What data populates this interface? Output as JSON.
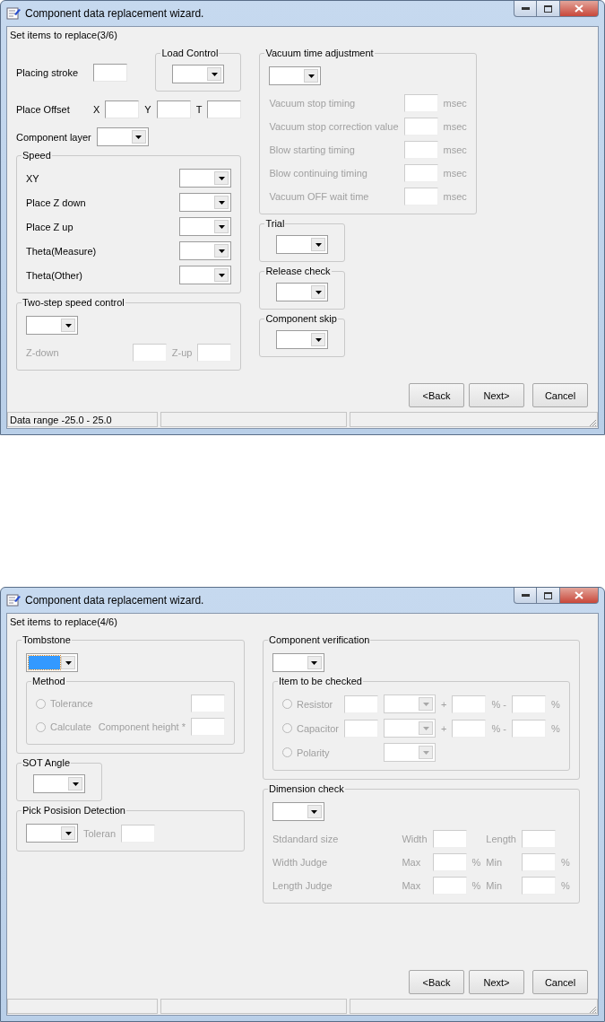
{
  "windows": [
    {
      "title": "Component data replacement wizard.",
      "subtitle": "Set items to replace(3/6)",
      "columns": [
        [
          {
            "kind": "row",
            "disabled": false,
            "parts": [
              {
                "kind": "label",
                "text": "Placing stroke"
              },
              {
                "kind": "field"
              },
              {
                "kind": "group",
                "title": "Load Control",
                "items": [
                  {
                    "kind": "row",
                    "disabled": false,
                    "parts": [
                      {
                        "kind": "combo"
                      }
                    ]
                  }
                ]
              }
            ]
          },
          {
            "kind": "row",
            "disabled": false,
            "parts": [
              {
                "kind": "label",
                "text": "Place Offset"
              },
              {
                "kind": "label",
                "text": "X"
              },
              {
                "kind": "field"
              },
              {
                "kind": "label",
                "text": "Y"
              },
              {
                "kind": "field"
              },
              {
                "kind": "label",
                "text": "T"
              },
              {
                "kind": "field"
              }
            ]
          },
          {
            "kind": "row",
            "disabled": false,
            "parts": [
              {
                "kind": "label",
                "text": "Component layer"
              },
              {
                "kind": "combo"
              }
            ]
          },
          {
            "kind": "group",
            "title": "Speed",
            "items": [
              {
                "kind": "table",
                "rows": [
                  {
                    "disabled": false,
                    "parts": [
                      {
                        "kind": "label",
                        "text": "XY"
                      },
                      {
                        "kind": "combo"
                      }
                    ]
                  },
                  {
                    "disabled": false,
                    "parts": [
                      {
                        "kind": "label",
                        "text": "Place Z down"
                      },
                      {
                        "kind": "combo"
                      }
                    ]
                  },
                  {
                    "disabled": false,
                    "parts": [
                      {
                        "kind": "label",
                        "text": "Place Z up"
                      },
                      {
                        "kind": "combo"
                      }
                    ]
                  },
                  {
                    "disabled": false,
                    "parts": [
                      {
                        "kind": "label",
                        "text": "Theta(Measure)"
                      },
                      {
                        "kind": "combo"
                      }
                    ]
                  },
                  {
                    "disabled": false,
                    "parts": [
                      {
                        "kind": "label",
                        "text": "Theta(Other)"
                      },
                      {
                        "kind": "combo"
                      }
                    ]
                  }
                ]
              }
            ]
          },
          {
            "kind": "group",
            "title": "Two-step speed control",
            "items": [
              {
                "kind": "row",
                "disabled": false,
                "parts": [
                  {
                    "kind": "combo"
                  }
                ]
              },
              {
                "kind": "table",
                "rows": [
                  {
                    "disabled": true,
                    "parts": [
                      {
                        "kind": "label",
                        "text": "Z-down"
                      },
                      {
                        "kind": "field"
                      },
                      {
                        "kind": "label",
                        "text": "Z-up"
                      },
                      {
                        "kind": "field"
                      }
                    ]
                  }
                ]
              }
            ]
          }
        ],
        [
          {
            "kind": "group",
            "title": "Vacuum time adjustment",
            "items": [
              {
                "kind": "row",
                "disabled": false,
                "parts": [
                  {
                    "kind": "combo"
                  }
                ]
              },
              {
                "kind": "table",
                "rows": [
                  {
                    "disabled": true,
                    "parts": [
                      {
                        "kind": "label",
                        "text": "Vacuum stop timing"
                      },
                      {
                        "kind": "field"
                      },
                      {
                        "kind": "unit",
                        "text": "msec"
                      }
                    ]
                  },
                  {
                    "disabled": true,
                    "parts": [
                      {
                        "kind": "label",
                        "text": "Vacuum stop correction value"
                      },
                      {
                        "kind": "field"
                      },
                      {
                        "kind": "unit",
                        "text": "msec"
                      }
                    ]
                  },
                  {
                    "disabled": true,
                    "parts": [
                      {
                        "kind": "label",
                        "text": "Blow starting timing"
                      },
                      {
                        "kind": "field"
                      },
                      {
                        "kind": "unit",
                        "text": "msec"
                      }
                    ]
                  },
                  {
                    "disabled": true,
                    "parts": [
                      {
                        "kind": "label",
                        "text": "Blow continuing timing"
                      },
                      {
                        "kind": "field"
                      },
                      {
                        "kind": "unit",
                        "text": "msec"
                      }
                    ]
                  },
                  {
                    "disabled": true,
                    "parts": [
                      {
                        "kind": "label",
                        "text": "Vacuum OFF wait time"
                      },
                      {
                        "kind": "field"
                      },
                      {
                        "kind": "unit",
                        "text": "msec"
                      }
                    ]
                  }
                ]
              }
            ]
          },
          {
            "kind": "group",
            "title": "Trial",
            "items": [
              {
                "kind": "row",
                "disabled": false,
                "parts": [
                  {
                    "kind": "combo"
                  }
                ]
              }
            ]
          },
          {
            "kind": "group",
            "title": "Release check",
            "items": [
              {
                "kind": "row",
                "disabled": false,
                "parts": [
                  {
                    "kind": "combo"
                  }
                ]
              }
            ]
          },
          {
            "kind": "group",
            "title": "Component skip",
            "items": [
              {
                "kind": "row",
                "disabled": false,
                "parts": [
                  {
                    "kind": "combo"
                  }
                ]
              }
            ]
          }
        ]
      ],
      "buttons": [
        {
          "label": "<Back"
        },
        {
          "label": "Next>"
        },
        {
          "label": "Cancel"
        }
      ],
      "status_text": "Data range  -25.0 - 25.0"
    },
    {
      "title": "Component data replacement wizard.",
      "subtitle": "Set items to replace(4/6)",
      "columns": [
        [
          {
            "kind": "group",
            "title": "Tombstone",
            "items": [
              {
                "kind": "row",
                "disabled": false,
                "parts": [
                  {
                    "kind": "combo",
                    "focused": true
                  }
                ]
              },
              {
                "kind": "group",
                "title": "Method",
                "items": [
                  {
                    "kind": "table",
                    "rows": [
                      {
                        "disabled": true,
                        "parts": [
                          {
                            "kind": "radio",
                            "text": "Tolerance",
                            "checked": false
                          },
                          {
                            "kind": "field"
                          }
                        ]
                      },
                      {
                        "disabled": true,
                        "parts": [
                          {
                            "kind": "radio",
                            "text": "Calculate",
                            "checked": false
                          },
                          {
                            "kind": "label",
                            "text": "Component height *"
                          },
                          {
                            "kind": "field"
                          }
                        ]
                      }
                    ]
                  }
                ]
              }
            ]
          },
          {
            "kind": "group",
            "title": "SOT Angle",
            "items": [
              {
                "kind": "row",
                "disabled": false,
                "parts": [
                  {
                    "kind": "combo"
                  }
                ]
              }
            ]
          },
          {
            "kind": "group",
            "title": "Pick Posision Detection",
            "items": [
              {
                "kind": "row",
                "parts": [
                  {
                    "kind": "combo",
                    "disabled": false
                  },
                  {
                    "kind": "label",
                    "text": "Toleran",
                    "disabled": true
                  },
                  {
                    "kind": "field",
                    "disabled": true
                  }
                ]
              }
            ]
          }
        ],
        [
          {
            "kind": "group",
            "title": "Component verification",
            "items": [
              {
                "kind": "row",
                "disabled": false,
                "parts": [
                  {
                    "kind": "combo"
                  }
                ]
              },
              {
                "kind": "group",
                "title": "Item to be checked",
                "items": [
                  {
                    "kind": "table",
                    "rows": [
                      {
                        "disabled": true,
                        "parts": [
                          {
                            "kind": "radio",
                            "text": "Resistor",
                            "checked": false
                          },
                          {
                            "kind": "field"
                          },
                          {
                            "kind": "combo"
                          },
                          {
                            "kind": "unit",
                            "text": "+"
                          },
                          {
                            "kind": "field"
                          },
                          {
                            "kind": "unit",
                            "text": "% -"
                          },
                          {
                            "kind": "field"
                          },
                          {
                            "kind": "unit",
                            "text": "%"
                          }
                        ]
                      },
                      {
                        "disabled": true,
                        "parts": [
                          {
                            "kind": "radio",
                            "text": "Capacitor",
                            "checked": false
                          },
                          {
                            "kind": "field"
                          },
                          {
                            "kind": "combo"
                          },
                          {
                            "kind": "unit",
                            "text": "+"
                          },
                          {
                            "kind": "field"
                          },
                          {
                            "kind": "unit",
                            "text": "% -"
                          },
                          {
                            "kind": "field"
                          },
                          {
                            "kind": "unit",
                            "text": "%"
                          }
                        ]
                      },
                      {
                        "disabled": true,
                        "parts": [
                          {
                            "kind": "radio",
                            "text": "Polarity",
                            "checked": false
                          },
                          {
                            "kind": "combo"
                          }
                        ]
                      }
                    ]
                  }
                ]
              }
            ]
          },
          {
            "kind": "group",
            "title": "Dimension check",
            "items": [
              {
                "kind": "row",
                "disabled": false,
                "parts": [
                  {
                    "kind": "combo"
                  }
                ]
              },
              {
                "kind": "table",
                "rows": [
                  {
                    "disabled": true,
                    "parts": [
                      {
                        "kind": "label",
                        "text": "Stdandard size"
                      },
                      {
                        "kind": "label",
                        "text": "Width"
                      },
                      {
                        "kind": "field"
                      },
                      {
                        "kind": "label",
                        "text": "Length"
                      },
                      {
                        "kind": "field"
                      }
                    ]
                  },
                  {
                    "disabled": true,
                    "parts": [
                      {
                        "kind": "label",
                        "text": "Width Judge"
                      },
                      {
                        "kind": "label",
                        "text": "Max"
                      },
                      {
                        "kind": "field"
                      },
                      {
                        "kind": "unit",
                        "text": "%"
                      },
                      {
                        "kind": "label",
                        "text": "Min"
                      },
                      {
                        "kind": "field"
                      },
                      {
                        "kind": "unit",
                        "text": "%"
                      }
                    ]
                  },
                  {
                    "disabled": true,
                    "parts": [
                      {
                        "kind": "label",
                        "text": "Length Judge"
                      },
                      {
                        "kind": "label",
                        "text": "Max"
                      },
                      {
                        "kind": "field"
                      },
                      {
                        "kind": "unit",
                        "text": "%"
                      },
                      {
                        "kind": "label",
                        "text": "Min"
                      },
                      {
                        "kind": "field"
                      },
                      {
                        "kind": "unit",
                        "text": "%"
                      }
                    ]
                  }
                ]
              }
            ]
          }
        ]
      ],
      "buttons": [
        {
          "label": "<Back"
        },
        {
          "label": "Next>"
        },
        {
          "label": "Cancel"
        }
      ]
    }
  ]
}
